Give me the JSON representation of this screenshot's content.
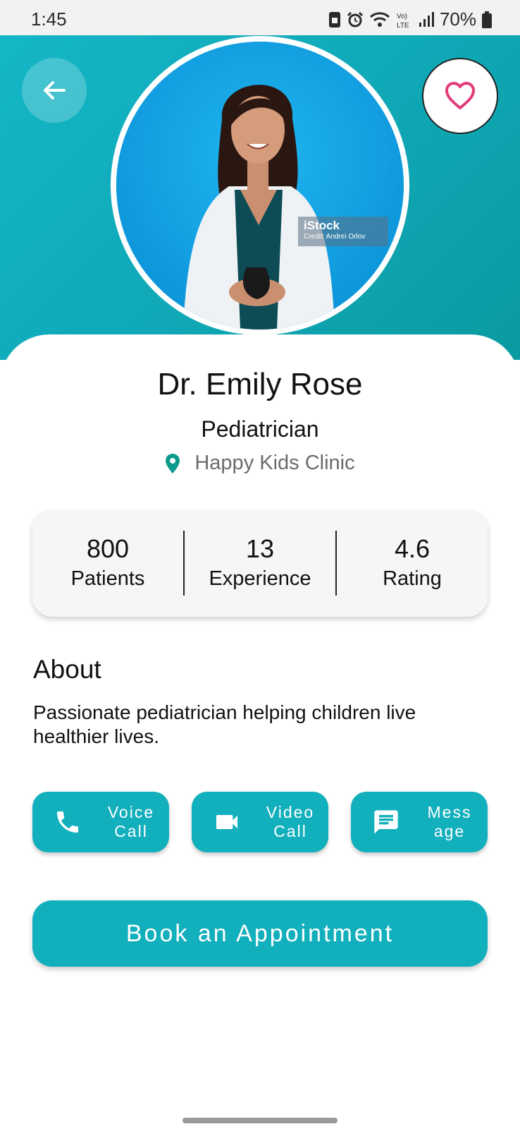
{
  "status_bar": {
    "time": "1:45",
    "battery": "70%",
    "icons": [
      "sim-icon",
      "alarm-icon",
      "wifi-icon",
      "volte-icon",
      "signal-icon",
      "battery-icon"
    ]
  },
  "header": {
    "back_icon": "arrow-left-icon",
    "favorite_icon": "heart-outline-icon",
    "photo_watermark": {
      "brand": "iStock",
      "credit": "Credit: Andrei Orlov"
    }
  },
  "doctor": {
    "name": "Dr. Emily Rose",
    "specialty": "Pediatrician",
    "clinic": "Happy Kids Clinic",
    "location_icon": "location-pin-icon"
  },
  "stats": [
    {
      "value": "800",
      "label": "Patients"
    },
    {
      "value": "13",
      "label": "Experience"
    },
    {
      "value": "4.6",
      "label": "Rating"
    }
  ],
  "about": {
    "title": "About",
    "text": "Passionate pediatrician helping children live healthier lives."
  },
  "actions": [
    {
      "label": "Voice\nCall",
      "icon": "phone-icon"
    },
    {
      "label": "Video\nCall",
      "icon": "video-camera-icon"
    },
    {
      "label": "Mess\nage",
      "icon": "message-icon"
    }
  ],
  "book_button": "Book an Appointment",
  "colors": {
    "accent": "#12afbc",
    "header_start": "#14b6c6",
    "header_end": "#0a9aa0",
    "location_pin": "#0f9a8e",
    "favorite": "#e23b7a"
  }
}
